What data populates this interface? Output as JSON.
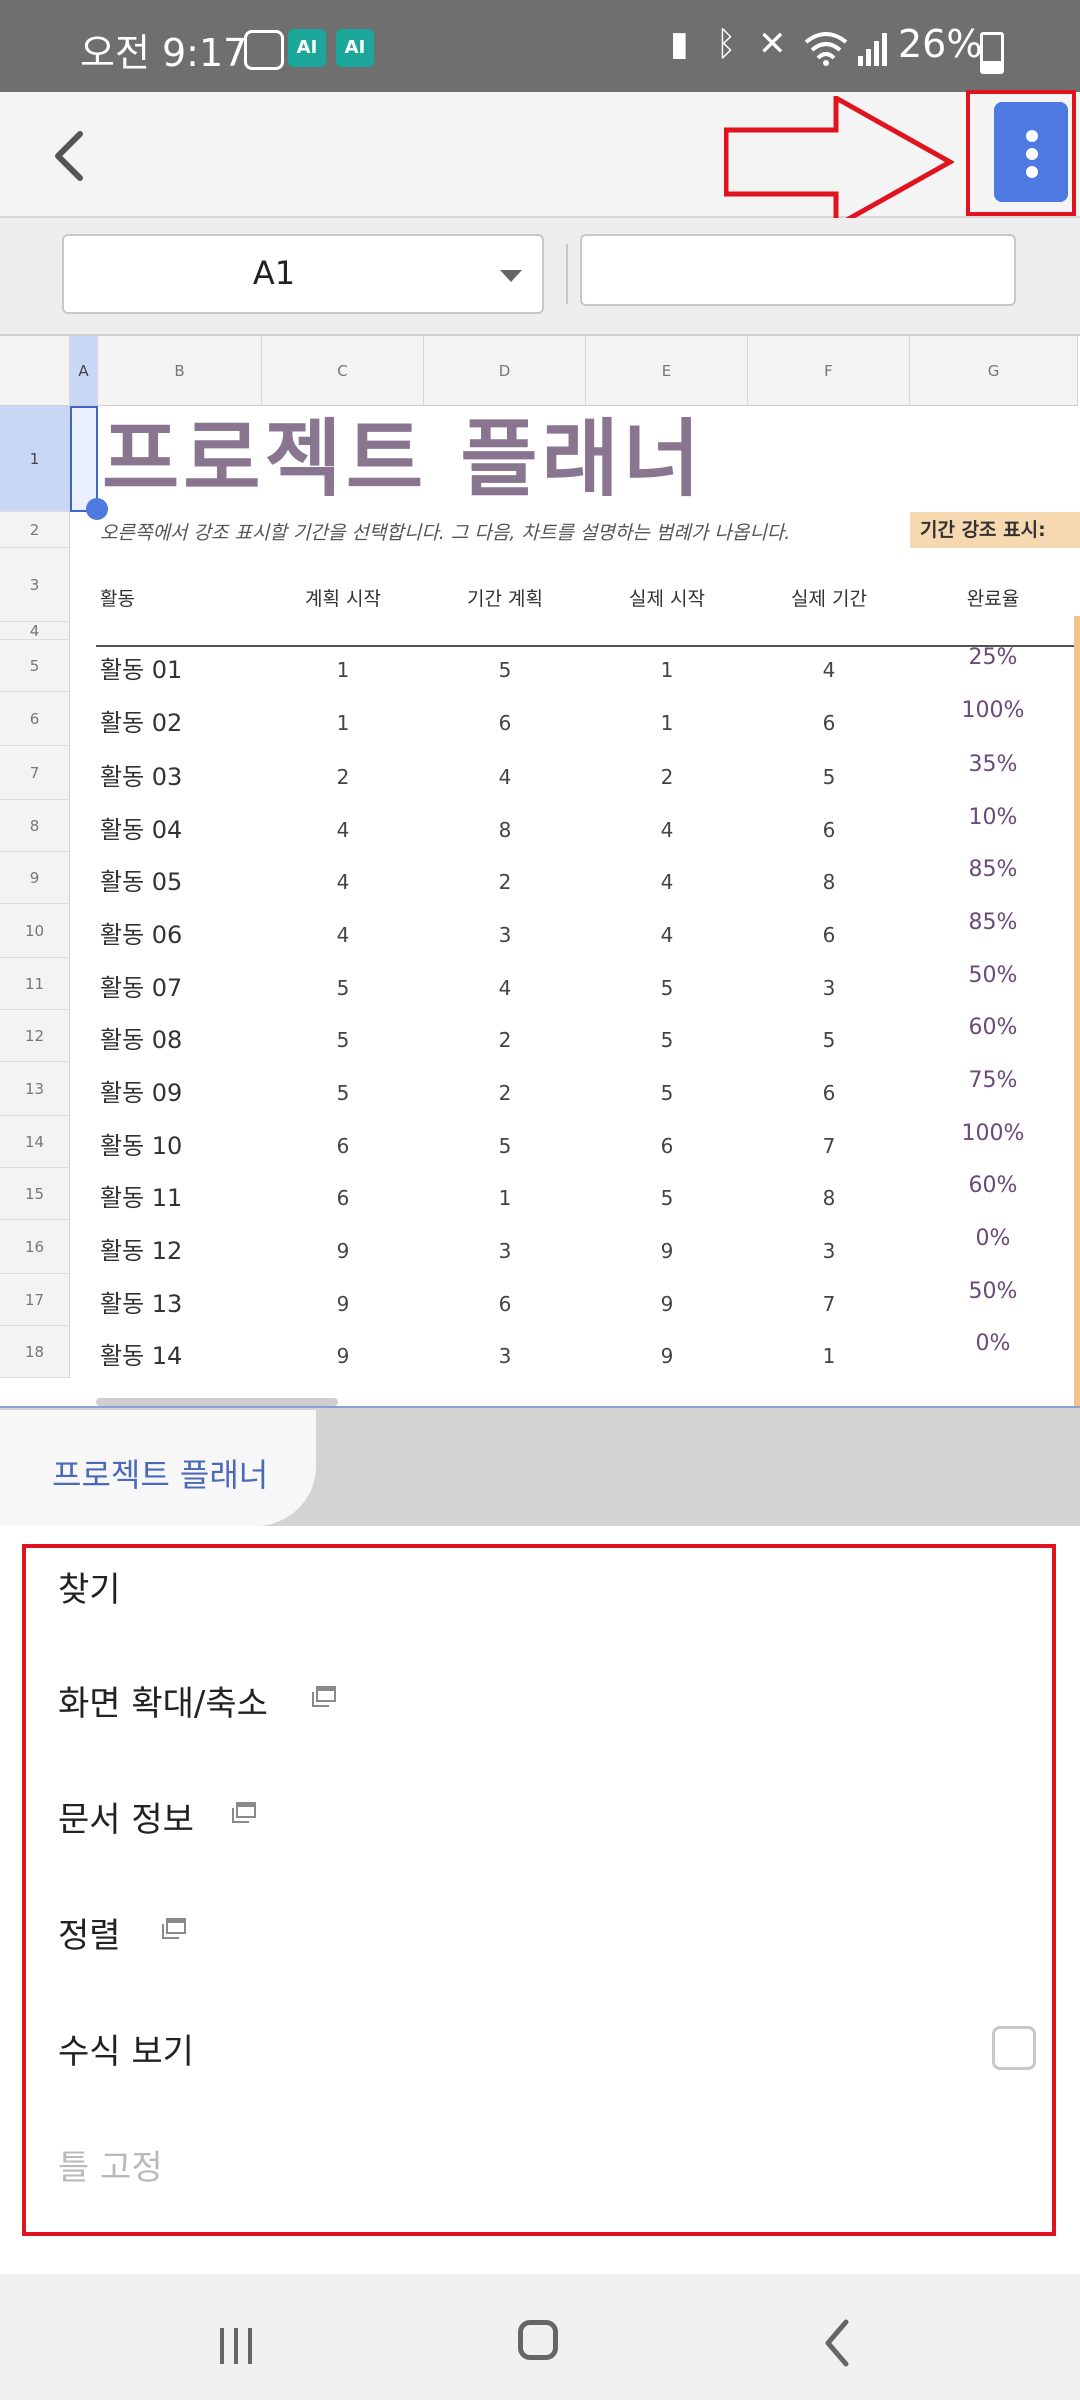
{
  "status_bar": {
    "time": "오전 9:17",
    "battery_percent": "26%",
    "ai_badges": [
      "AI",
      "AI"
    ],
    "icons": [
      "chat-icon",
      "battery-saver-icon",
      "bluetooth-icon",
      "mute-icon",
      "wifi-icon",
      "signal-icon",
      "battery-icon"
    ]
  },
  "toolbar": {
    "back_icon": "chevron-left-icon",
    "more_icon": "kebab-menu-icon"
  },
  "formula_bar": {
    "cell_reference": "A1",
    "formula_value": ""
  },
  "sheet": {
    "columns": [
      "A",
      "B",
      "C",
      "D",
      "E",
      "F",
      "G"
    ],
    "rows": [
      "1",
      "2",
      "3",
      "4",
      "5",
      "6",
      "7",
      "8",
      "9",
      "10",
      "11",
      "12",
      "13",
      "14",
      "15",
      "16",
      "17",
      "18"
    ],
    "title": "프로젝트 플래너",
    "subtitle": "오른쪽에서 강조 표시할 기간을 선택합니다. 그 다음, 차트를 설명하는 범례가 나옵니다.",
    "period_highlight_label": "기간 강조 표시:",
    "headers": [
      "활동",
      "계획 시작",
      "기간 계획",
      "실제 시작",
      "실제 기간",
      "완료율"
    ],
    "table_rows": [
      {
        "activity": "활동 01",
        "plan_start": "1",
        "plan_duration": "5",
        "actual_start": "1",
        "actual_duration": "4",
        "percent": "25%"
      },
      {
        "activity": "활동 02",
        "plan_start": "1",
        "plan_duration": "6",
        "actual_start": "1",
        "actual_duration": "6",
        "percent": "100%"
      },
      {
        "activity": "활동 03",
        "plan_start": "2",
        "plan_duration": "4",
        "actual_start": "2",
        "actual_duration": "5",
        "percent": "35%"
      },
      {
        "activity": "활동 04",
        "plan_start": "4",
        "plan_duration": "8",
        "actual_start": "4",
        "actual_duration": "6",
        "percent": "10%"
      },
      {
        "activity": "활동 05",
        "plan_start": "4",
        "plan_duration": "2",
        "actual_start": "4",
        "actual_duration": "8",
        "percent": "85%"
      },
      {
        "activity": "활동 06",
        "plan_start": "4",
        "plan_duration": "3",
        "actual_start": "4",
        "actual_duration": "6",
        "percent": "85%"
      },
      {
        "activity": "활동 07",
        "plan_start": "5",
        "plan_duration": "4",
        "actual_start": "5",
        "actual_duration": "3",
        "percent": "50%"
      },
      {
        "activity": "활동 08",
        "plan_start": "5",
        "plan_duration": "2",
        "actual_start": "5",
        "actual_duration": "5",
        "percent": "60%"
      },
      {
        "activity": "활동 09",
        "plan_start": "5",
        "plan_duration": "2",
        "actual_start": "5",
        "actual_duration": "6",
        "percent": "75%"
      },
      {
        "activity": "활동 10",
        "plan_start": "6",
        "plan_duration": "5",
        "actual_start": "6",
        "actual_duration": "7",
        "percent": "100%"
      },
      {
        "activity": "활동 11",
        "plan_start": "6",
        "plan_duration": "1",
        "actual_start": "5",
        "actual_duration": "8",
        "percent": "60%"
      },
      {
        "activity": "활동 12",
        "plan_start": "9",
        "plan_duration": "3",
        "actual_start": "9",
        "actual_duration": "3",
        "percent": "0%"
      },
      {
        "activity": "활동 13",
        "plan_start": "9",
        "plan_duration": "6",
        "actual_start": "9",
        "actual_duration": "7",
        "percent": "50%"
      },
      {
        "activity": "활동 14",
        "plan_start": "9",
        "plan_duration": "3",
        "actual_start": "9",
        "actual_duration": "1",
        "percent": "0%"
      }
    ]
  },
  "sheet_tabs": {
    "active": "프로젝트 플래너"
  },
  "menu": {
    "items": [
      {
        "label": "찾기",
        "icon": "",
        "checkbox": false,
        "enabled": true
      },
      {
        "label": "화면 확대/축소",
        "icon": "popup-window-icon",
        "checkbox": false,
        "enabled": true
      },
      {
        "label": "문서 정보",
        "icon": "popup-window-icon",
        "checkbox": false,
        "enabled": true
      },
      {
        "label": "정렬",
        "icon": "popup-window-icon",
        "checkbox": false,
        "enabled": true
      },
      {
        "label": "수식 보기",
        "icon": "",
        "checkbox": true,
        "checked": false,
        "enabled": true
      },
      {
        "label": "틀 고정",
        "icon": "",
        "checkbox": false,
        "enabled": false
      }
    ]
  },
  "nav_bar": {
    "icons": [
      "recents-icon",
      "home-icon",
      "back-icon"
    ]
  },
  "colors": {
    "accent": "#4d79e0",
    "annotation_red": "#e0141e",
    "title_purple": "#8a7591",
    "legend_bg": "#f6d9b0"
  }
}
